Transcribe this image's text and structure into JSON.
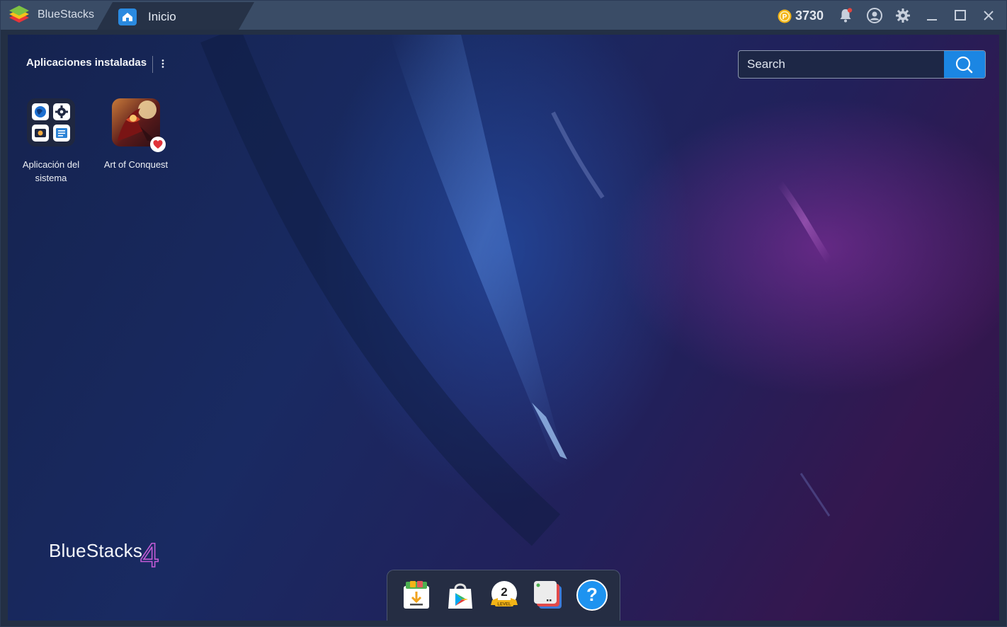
{
  "titlebar": {
    "app_name": "BlueStacks",
    "tab_label": "Inicio",
    "coin_count": "3730",
    "icons": [
      "bluestacks-logo",
      "home-icon",
      "coin-icon",
      "bell-icon",
      "profile-icon",
      "gear-icon",
      "minimize-icon",
      "maximize-icon",
      "close-icon"
    ]
  },
  "main": {
    "section_title": "Aplicaciones instaladas",
    "search_placeholder": "Search",
    "apps": [
      {
        "label": "Aplicación del sistema",
        "icon": "system-apps-icon"
      },
      {
        "label": "Art of Conquest",
        "icon": "art-of-conquest-icon",
        "badge": "heart-icon"
      }
    ],
    "brand_text": "BlueStacks",
    "brand_number": "4"
  },
  "dock": {
    "items": [
      "download-icon",
      "play-store-icon",
      "level-badge-icon",
      "multi-instance-icon",
      "help-icon"
    ],
    "level_number": "2",
    "level_caption": "LEVEL"
  },
  "colors": {
    "titlebar": "#3a4c66",
    "accent_blue": "#1b86e3",
    "notification_dot": "#e0453f"
  }
}
